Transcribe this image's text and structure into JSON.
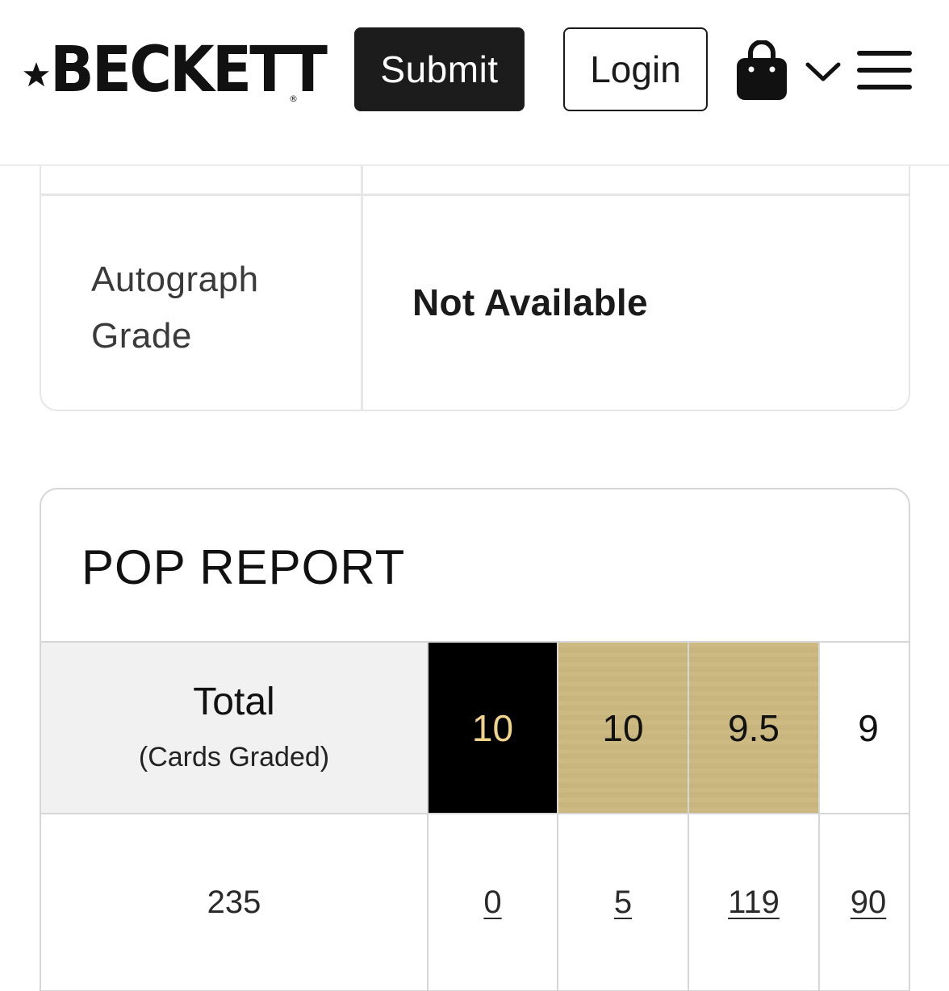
{
  "header": {
    "logo_text": "BECKETT",
    "logo_reg": "®",
    "submit_label": "Submit",
    "login_label": "Login",
    "icons": [
      "star-icon",
      "shopping-bag-icon",
      "chevron-down-icon",
      "hamburger-menu-icon"
    ]
  },
  "details": {
    "autograph_label": "Autograph Grade",
    "autograph_value": "Not Available"
  },
  "pop_report": {
    "title": "POP REPORT",
    "total_header": "Total",
    "total_subheader": "(Cards Graded)",
    "grades": [
      {
        "label": "10",
        "count": "0",
        "style": "black-label"
      },
      {
        "label": "10",
        "count": "5",
        "style": "gold-label"
      },
      {
        "label": "9.5",
        "count": "119",
        "style": "gold-label"
      },
      {
        "label": "9",
        "count": "90",
        "style": "plain"
      }
    ],
    "total_value": "235"
  },
  "colors": {
    "black_label_bg": "#000000",
    "black_label_text": "#f2d38a",
    "gold_label_bg": "#cdb982",
    "header_bg": "#f1f1f1",
    "submit_bg": "#1c1c1c"
  }
}
